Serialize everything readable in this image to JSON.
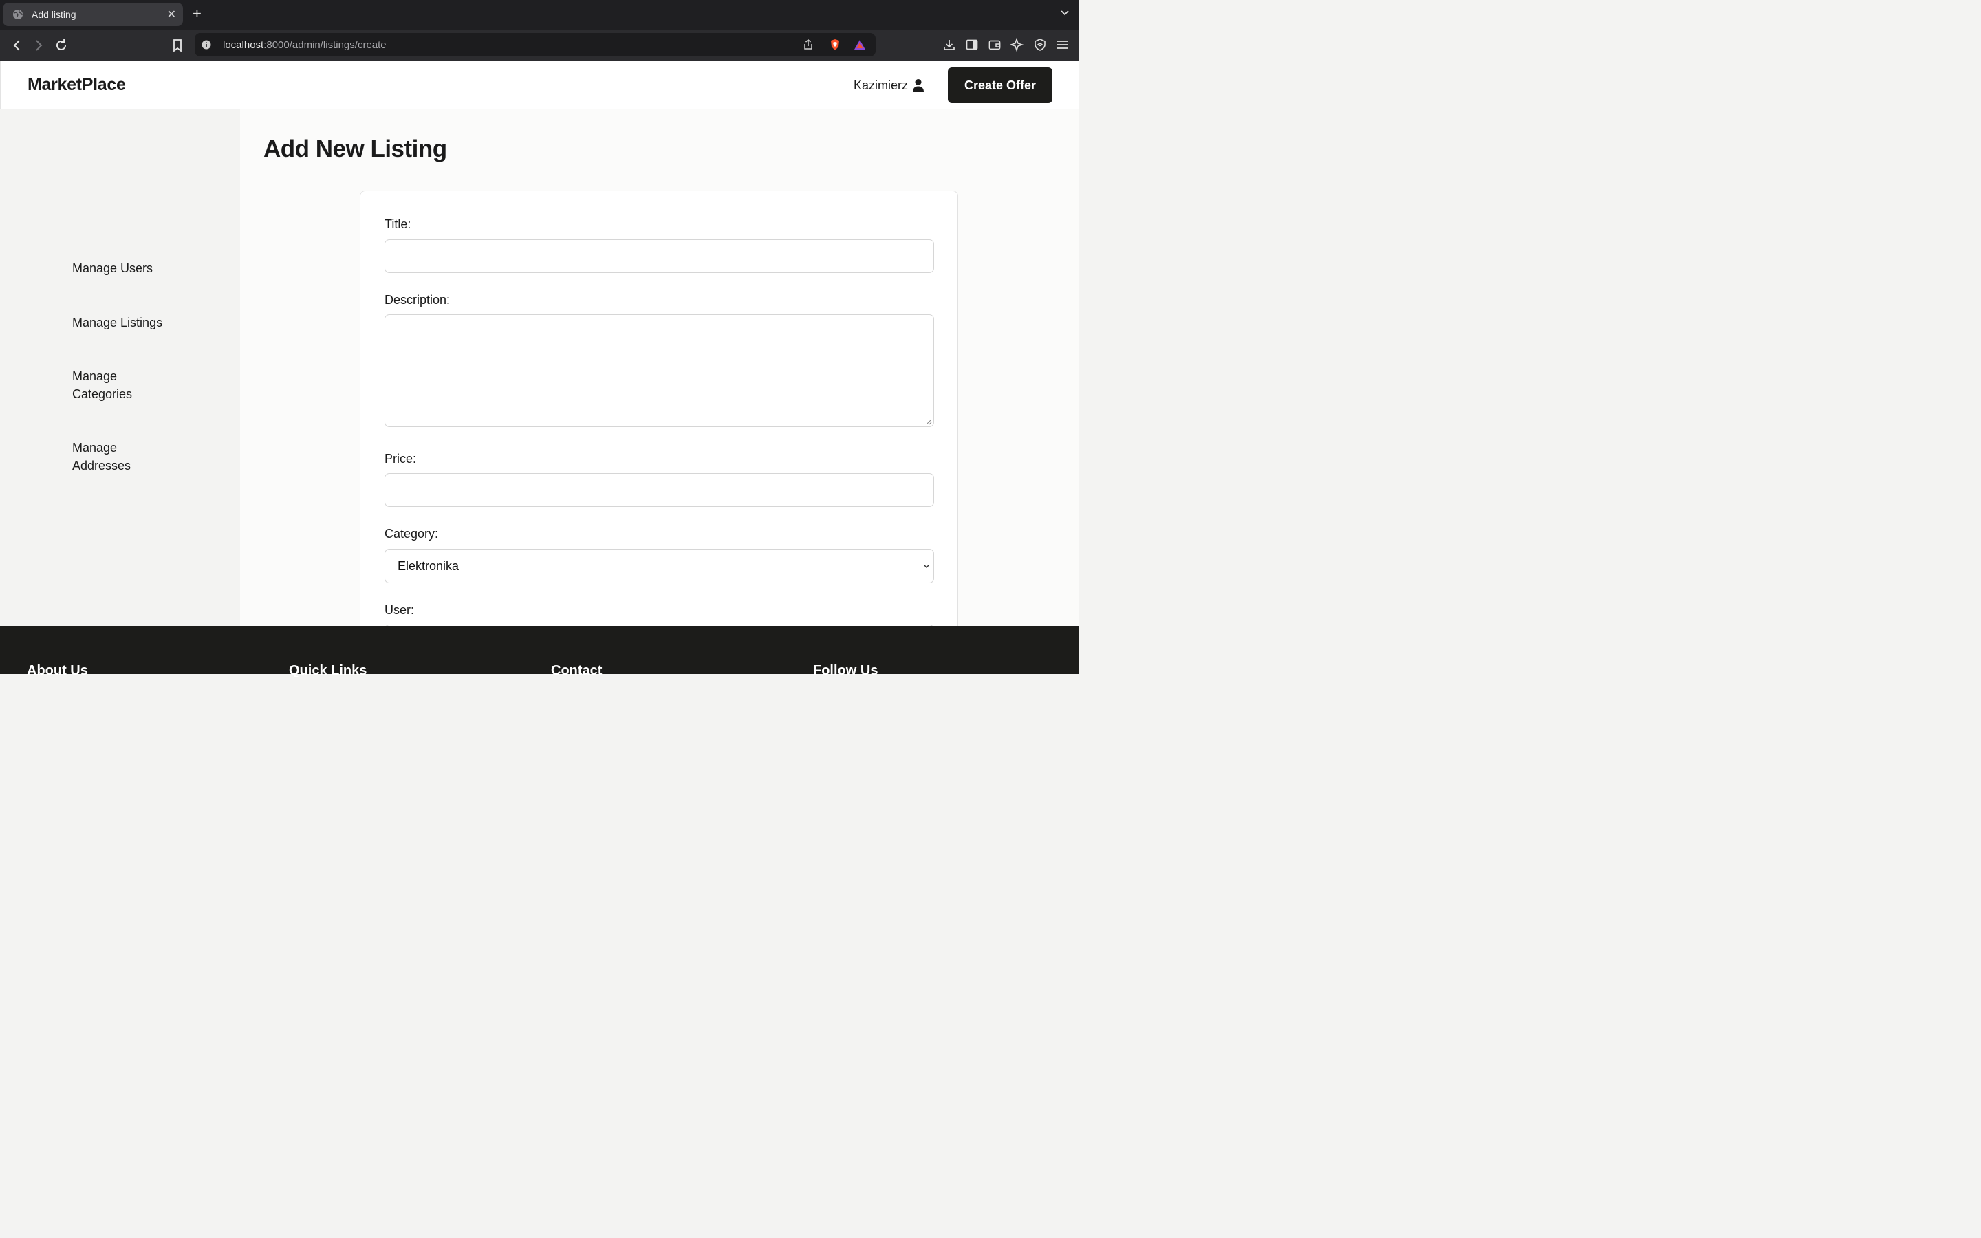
{
  "browser": {
    "tab_title": "Add listing",
    "tab_close": "✕",
    "new_tab": "+",
    "url_host": "localhost",
    "url_rest": ":8000/admin/listings/create"
  },
  "header": {
    "brand": "MarketPlace",
    "user_name": "Kazimierz",
    "create_label": "Create Offer"
  },
  "sidebar": {
    "items": [
      {
        "label": "Manage Users"
      },
      {
        "label": "Manage Listings"
      },
      {
        "label": "Manage Categories"
      },
      {
        "label": "Manage Addresses"
      }
    ]
  },
  "main": {
    "title": "Add New Listing",
    "form": {
      "title_label": "Title:",
      "title_value": "",
      "description_label": "Description:",
      "description_value": "",
      "price_label": "Price:",
      "price_value": "",
      "category_label": "Category:",
      "category_value": "Elektronika",
      "user_label": "User:"
    }
  },
  "footer": {
    "columns": [
      "About Us",
      "Quick Links",
      "Contact",
      "Follow Us"
    ]
  }
}
